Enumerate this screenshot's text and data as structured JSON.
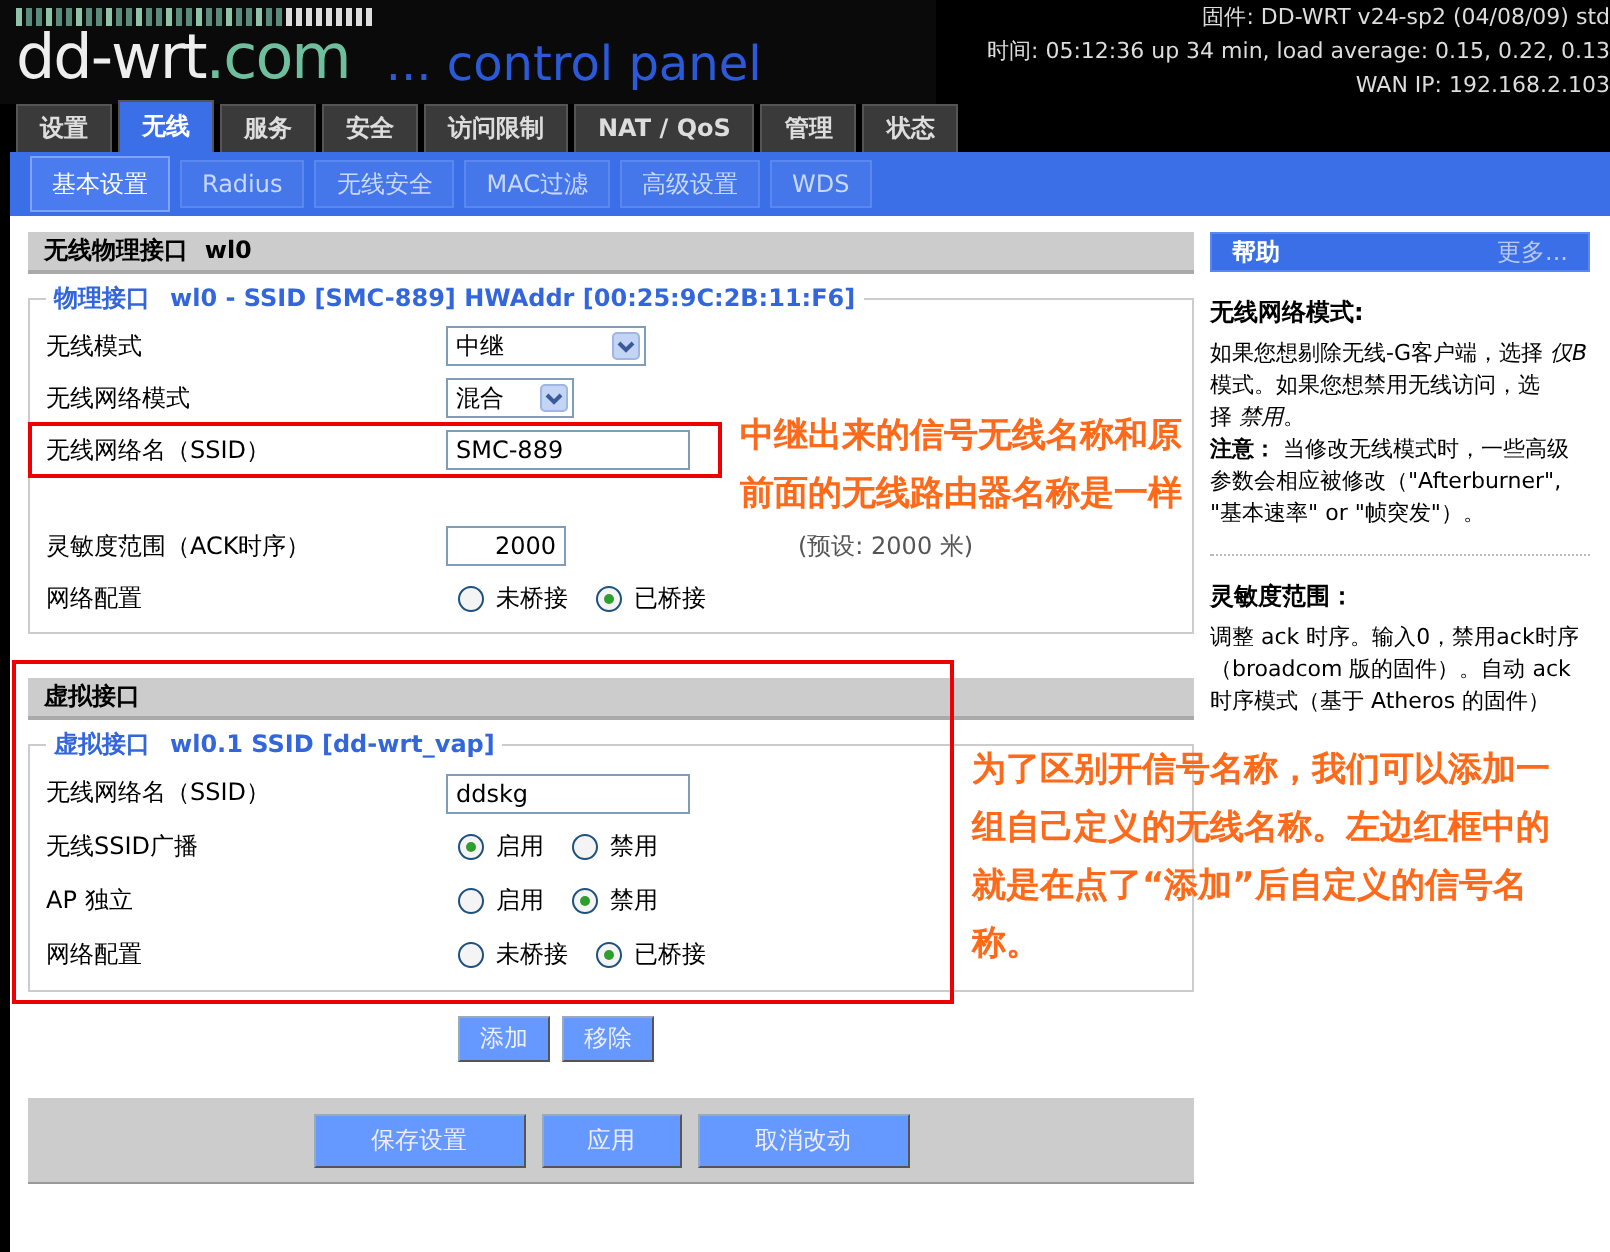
{
  "header": {
    "logo": "dd-wrt",
    "logo_suffix": ".com",
    "tagline": "... control panel",
    "info": [
      "固件: DD-WRT v24-sp2 (04/08/09) std",
      "时间: 05:12:36 up 34 min, load average: 0.15, 0.22, 0.13",
      "WAN IP: 192.168.2.103"
    ]
  },
  "tabs": [
    {
      "label": "设置",
      "selected": false
    },
    {
      "label": "无线",
      "selected": true
    },
    {
      "label": "服务",
      "selected": false
    },
    {
      "label": "安全",
      "selected": false
    },
    {
      "label": "访问限制",
      "selected": false
    },
    {
      "label": "NAT / QoS",
      "selected": false
    },
    {
      "label": "管理",
      "selected": false
    },
    {
      "label": "状态",
      "selected": false
    }
  ],
  "subtabs": [
    {
      "label": "基本设置",
      "selected": true
    },
    {
      "label": "Radius",
      "selected": false
    },
    {
      "label": "无线安全",
      "selected": false
    },
    {
      "label": "MAC过滤",
      "selected": false
    },
    {
      "label": "高级设置",
      "selected": false
    },
    {
      "label": "WDS",
      "selected": false
    }
  ],
  "sections": [
    {
      "title": "无线物理接口  wl0",
      "legend": "物理接口",
      "legend_detail": "wl0 - SSID [SMC-889] HWAddr [00:25:9C:2B:11:F6]",
      "highlighted": false,
      "rows": [
        {
          "kind": "select",
          "label": "无线模式",
          "value": "中继",
          "wide": true,
          "highlighted": false
        },
        {
          "kind": "select",
          "label": "无线网络模式",
          "value": "混合",
          "wide": false,
          "highlighted": false
        },
        {
          "kind": "text",
          "label": "无线网络名（SSID）",
          "value": "SMC-889",
          "highlighted": true
        },
        {
          "kind": "number",
          "label": "灵敏度范围（ACK时序）",
          "value": "2000",
          "hint": "(预设: 2000 米)",
          "highlighted": false
        },
        {
          "kind": "radio",
          "label": "网络配置",
          "options": [
            {
              "label": "未桥接",
              "selected": false
            },
            {
              "label": "已桥接",
              "selected": true
            }
          ],
          "highlighted": false
        }
      ]
    },
    {
      "title": "虚拟接口",
      "legend": "虚拟接口",
      "legend_detail": "wl0.1 SSID [dd-wrt_vap]",
      "highlighted": true,
      "rows": [
        {
          "kind": "text",
          "label": "无线网络名（SSID）",
          "value": "ddskg",
          "highlighted": false
        },
        {
          "kind": "radio",
          "label": "无线SSID广播",
          "options": [
            {
              "label": "启用",
              "selected": true
            },
            {
              "label": "禁用",
              "selected": false
            }
          ],
          "highlighted": false
        },
        {
          "kind": "radio",
          "label": "AP 独立",
          "options": [
            {
              "label": "启用",
              "selected": false
            },
            {
              "label": "禁用",
              "selected": true
            }
          ],
          "highlighted": false
        },
        {
          "kind": "radio",
          "label": "网络配置",
          "options": [
            {
              "label": "未桥接",
              "selected": false
            },
            {
              "label": "已桥接",
              "selected": true
            }
          ],
          "highlighted": false
        }
      ]
    }
  ],
  "interface_buttons": [
    "添加",
    "移除"
  ],
  "footer_buttons": [
    "保存设置",
    "应用",
    "取消改动"
  ],
  "help": {
    "title": "帮助",
    "more": "更多...",
    "topics": [
      {
        "heading": "无线网络模式:",
        "paragraphs": [
          "如果您想剔除无线-G客户端，选择 *仅B* 模式。如果您想禁用无线访问，选择 *禁用*。",
          "**注意：** 当修改无线模式时，一些高级参数会相应被修改（\"Afterburner\", \"基本速率\" or \"帧突发\"）。"
        ]
      },
      {
        "heading": "灵敏度范围：",
        "paragraphs": [
          "调整 ack 时序。输入0，禁用ack时序（broadcom 版的固件）。自动 ack 时序模式（基于 Atheros 的固件）"
        ]
      }
    ]
  },
  "annotations": [
    "中继出来的信号无线名称和原前面的无线路由器名称是一样",
    "为了区别开信号名称，我们可以添加一组自己定义的无线名称。左边红框中的就是在点了“添加”后自定义的信号名称。"
  ]
}
